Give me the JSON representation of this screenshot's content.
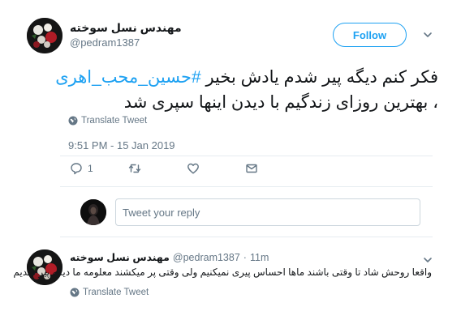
{
  "colors": {
    "accent": "#1da1f2",
    "secondary_text": "#657786",
    "border": "#e6ecf0"
  },
  "tweet": {
    "author_name": "مهندس نسل سوخته",
    "author_handle": "@pedram1387",
    "follow_label": "Follow",
    "text_line1_prefix": "فکر کنم دیگه پیر شدم یادش بخیر ",
    "hashtag": "#حسین_محب_اهری",
    "text_line2": "، بهترین روزای زندگیم با دیدن اینها سپری شد",
    "translate_label": "Translate Tweet",
    "timestamp": "9:51 PM - 15 Jan 2019",
    "reply_count": "1",
    "icons": [
      "reply-icon",
      "retweet-icon",
      "like-icon",
      "message-icon",
      "globe-icon",
      "chevron-down-icon"
    ]
  },
  "reply_box": {
    "placeholder": "Tweet your reply"
  },
  "reply": {
    "author_name": "مهندس نسل سوخته",
    "author_handle": "@pedram1387",
    "separator": "·",
    "time": "11m",
    "text": "واقعا روحش شاد تا وقتی باشند ماها احساس پیری نمیکنیم ولی وقتی پر میکشند معلومه ما دیگه پیر شدیم",
    "translate_label": "Translate Tweet"
  }
}
